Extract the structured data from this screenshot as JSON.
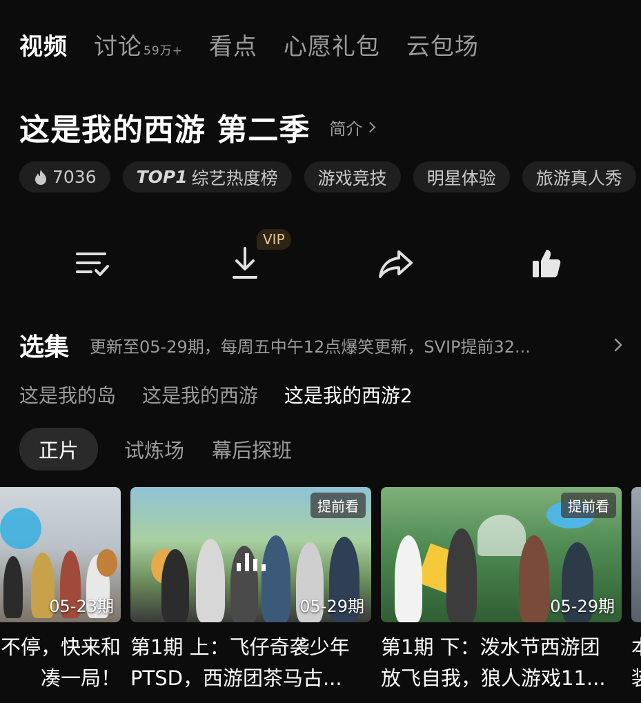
{
  "tabs": [
    {
      "label": "视频",
      "count": ""
    },
    {
      "label": "讨论",
      "count": "59万+"
    },
    {
      "label": "看点",
      "count": ""
    },
    {
      "label": "心愿礼包",
      "count": ""
    },
    {
      "label": "云包场",
      "count": ""
    }
  ],
  "show": {
    "title": "这是我的西游 第二季",
    "intro_label": "简介"
  },
  "tags": {
    "heat": "7036",
    "top_prefix": "TOP1",
    "top_label": "综艺热度榜",
    "items": [
      "游戏竞技",
      "明星体验",
      "旅游真人秀"
    ]
  },
  "actions": {
    "vip_badge": "VIP",
    "icons": [
      "playlist-icon",
      "download-icon",
      "share-icon",
      "like-icon"
    ]
  },
  "episodes": {
    "title": "选集",
    "subtitle": "更新至05-29期，每周五中午12点爆笑更新，SVIP提前32..."
  },
  "seasons": [
    "这是我的岛",
    "这是我的西游",
    "这是我的西游2"
  ],
  "subtabs": [
    "正片",
    "试炼场",
    "幕后探班"
  ],
  "cards": [
    {
      "date": "05-23期",
      "badge": "",
      "line1": "不停，快来和",
      "line2": "凑一局！"
    },
    {
      "date": "05-29期",
      "badge": "提前看",
      "line1": "第1期 上：飞仔奇袭少年",
      "line2": "PTSD，西游团茶马古..."
    },
    {
      "date": "05-29期",
      "badge": "提前看",
      "line1": "第1期 下：泼水节西游团",
      "line2": "放飞自我，狼人游戏11..."
    },
    {
      "date": "",
      "badge": "",
      "line1": "本",
      "line2": "装"
    }
  ],
  "colors": {
    "background": "#0c0c0c",
    "vip": "#e6c896",
    "muted": "#9a9a9a"
  }
}
